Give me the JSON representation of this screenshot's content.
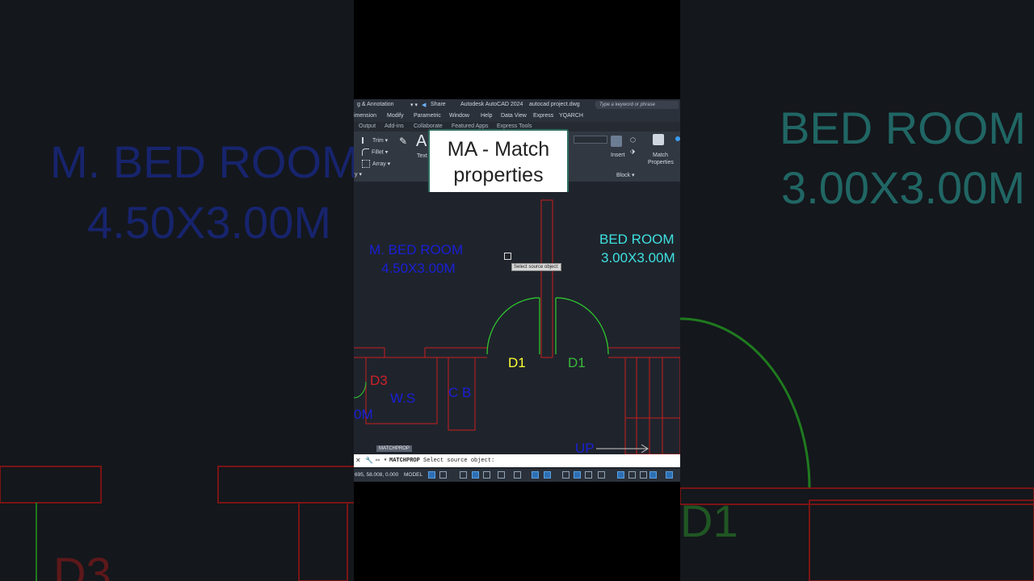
{
  "background": {
    "left_labels": [
      "M. BED ROOM",
      "4.50X3.00M",
      "D3"
    ],
    "right_labels": [
      "BED ROOM",
      "3.00X3.00M",
      "D1"
    ]
  },
  "titlebar": {
    "workspace": "g & Annotation",
    "share": "Share",
    "app_title": "Autodesk AutoCAD 2024",
    "file_name": "autocad project.dwg",
    "search_placeholder": "Type a keyword or phrase"
  },
  "menubar": {
    "items": [
      "imension",
      "Modify",
      "Parametric",
      "Window",
      "Help",
      "Data View",
      "Express",
      "YQARCH"
    ]
  },
  "tabs": {
    "items": [
      "Output",
      "Add-ins",
      "Collaborate",
      "Featured Apps",
      "Express Tools"
    ]
  },
  "ribbon": {
    "trim": "Trim",
    "fillet": "Fillet",
    "array": "Array",
    "text_glyph": "A",
    "text": "Text",
    "modify_panel": "y ▾",
    "insert": "Insert",
    "match_properties_line1": "Match",
    "match_properties_line2": "Properties",
    "block_panel": "Block ▾"
  },
  "overlay": {
    "line1": "MA - Match",
    "line2": "properties"
  },
  "drawing": {
    "mbed_name": "M. BED ROOM",
    "mbed_size": "4.50X3.00M",
    "bed_name": "BED ROOM",
    "bed_size": "3.00X3.00M",
    "door_d1_left": "D1",
    "door_d1_right": "D1",
    "door_d3": "D3",
    "ws": "W.S",
    "cb": "C B",
    "partial_size": "0M",
    "up": "UP",
    "cursor_prompt": "Select source object:",
    "colors": {
      "blue_text": "#1a1fd6",
      "cyan_text": "#3fe0e0",
      "yellow_text": "#ffff33",
      "green_text": "#3bb83b",
      "red_wall": "#c81e1e",
      "green_door": "#2fd12f"
    }
  },
  "command": {
    "history": "MATCHPROP",
    "name": "MATCHPROP",
    "prompt": "Select source object:"
  },
  "statusbar": {
    "coords": "695, 58.008, 0.000",
    "mode": "MODEL"
  }
}
